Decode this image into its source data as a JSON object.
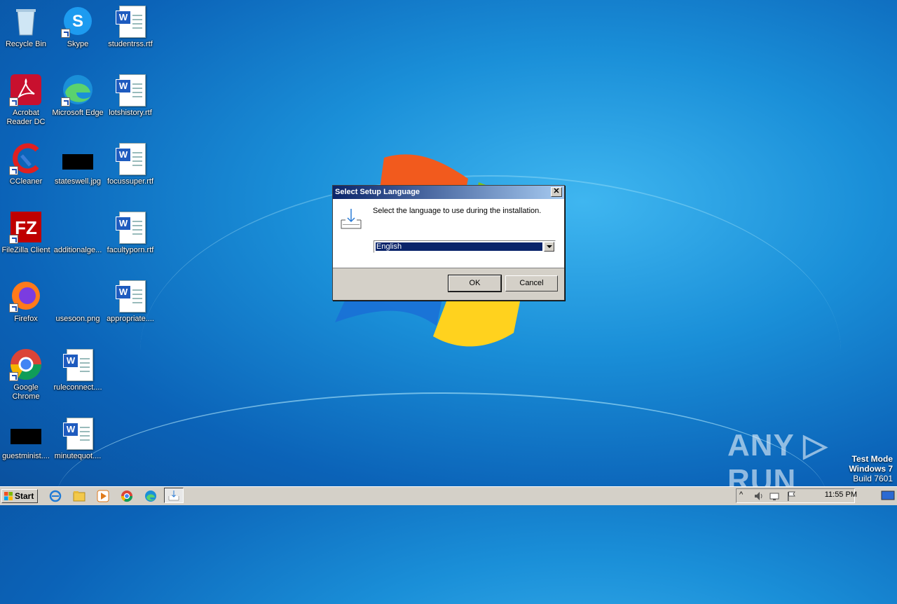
{
  "desktop": {
    "icons": [
      {
        "label": "Recycle Bin",
        "kind": "recycle-bin"
      },
      {
        "label": "Skype",
        "kind": "skype"
      },
      {
        "label": "studentrss.rtf",
        "kind": "word-doc"
      },
      {
        "label": "Acrobat Reader DC",
        "kind": "acrobat"
      },
      {
        "label": "Microsoft Edge",
        "kind": "edge"
      },
      {
        "label": "lotshistory.rtf",
        "kind": "word-doc"
      },
      {
        "label": "CCleaner",
        "kind": "ccleaner"
      },
      {
        "label": "stateswell.jpg",
        "kind": "image-thumb"
      },
      {
        "label": "focussuper.rtf",
        "kind": "word-doc"
      },
      {
        "label": "FileZilla Client",
        "kind": "filezilla"
      },
      {
        "label": "additionalge...",
        "kind": "image-blank"
      },
      {
        "label": "facultyporn.rtf",
        "kind": "word-doc"
      },
      {
        "label": "Firefox",
        "kind": "firefox"
      },
      {
        "label": "usesoon.png",
        "kind": "image-blank"
      },
      {
        "label": "appropriate....",
        "kind": "word-doc"
      },
      {
        "label": "Google Chrome",
        "kind": "chrome"
      },
      {
        "label": "ruleconnect....",
        "kind": "word-doc"
      },
      {
        "label": "guestminist....",
        "kind": "image-thumb"
      },
      {
        "label": "minutequot....",
        "kind": "word-doc"
      }
    ]
  },
  "dialog": {
    "title": "Select Setup Language",
    "close_glyph": "✕",
    "prompt": "Select the language to use during the installation.",
    "language_selected": "English",
    "ok_label": "OK",
    "cancel_label": "Cancel"
  },
  "taskbar": {
    "start_label": "Start",
    "clock": "11:55 PM"
  },
  "watermark": {
    "text": "ANY ▷ RUN"
  },
  "os_info": {
    "line1": "Test Mode",
    "line2": "Windows 7",
    "line3": "Build 7601"
  },
  "colors": {
    "titlebar_start": "#0a246a",
    "titlebar_end": "#a6caf0",
    "selection": "#0a246a"
  }
}
